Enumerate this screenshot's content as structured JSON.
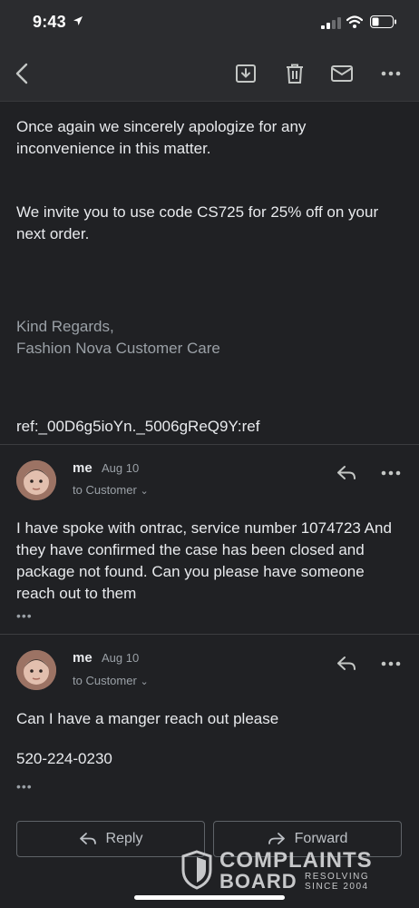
{
  "status_bar": {
    "time": "9:43"
  },
  "toolbar": {
    "back_icon": "chevron-left-icon",
    "archive_icon": "archive-icon",
    "trash_icon": "trash-icon",
    "mail_icon": "mail-icon",
    "more_icon": "more-horizontal-icon"
  },
  "quoted_message": {
    "apology": "Once again we sincerely apologize for any inconvenience in this matter.",
    "offer": "We invite you to use code CS725 for 25% off on your next order.",
    "regards": "Kind Regards,",
    "signature": "Fashion Nova Customer Care",
    "ref": "ref:_00D6g5ioYn._5006gReQ9Y:ref"
  },
  "messages": [
    {
      "sender": "me",
      "date": "Aug 10",
      "recipients": "to Customer",
      "body": "I have spoke with ontrac, service number 1074723 And they have confirmed the case has been closed and package not found. Can you please have someone reach out to them",
      "ellipsis": "•••"
    },
    {
      "sender": "me",
      "date": "Aug 10",
      "recipients": "to Customer",
      "body": "Can I have a manger reach out please",
      "phone": "520-224-0230",
      "ellipsis": "•••"
    }
  ],
  "actions": {
    "reply_label": "Reply",
    "forward_label": "Forward"
  },
  "watermark": {
    "line1": "COMPLAINTS",
    "line2": "BOARD",
    "tag1": "RESOLVING",
    "tag2": "SINCE 2004"
  },
  "colors": {
    "background": "#202124",
    "toolbar": "#2b2c2f",
    "text": "#e8eaed",
    "muted": "#9aa0a6"
  }
}
